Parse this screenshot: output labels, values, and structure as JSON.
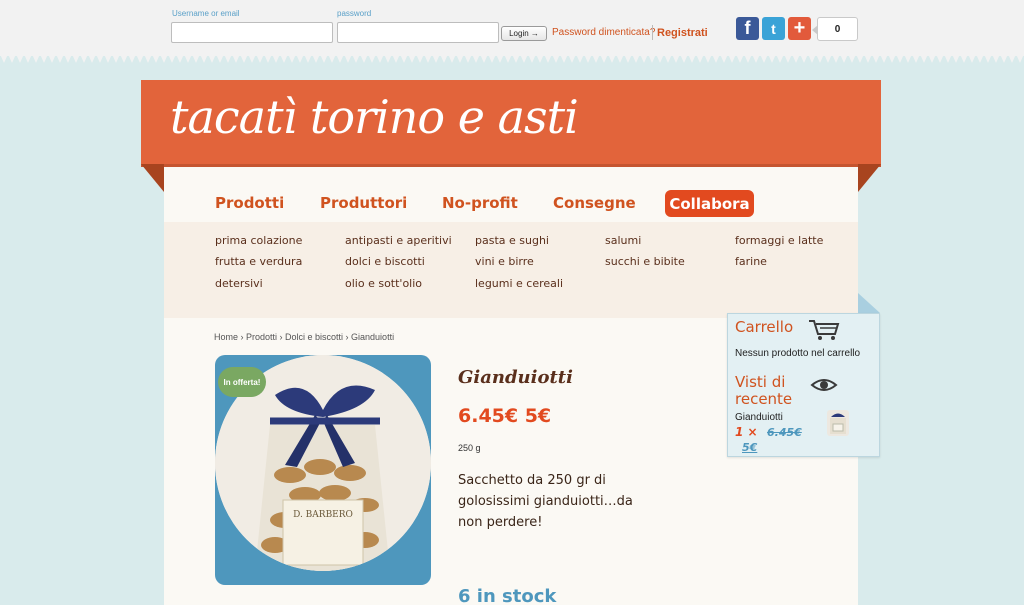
{
  "login": {
    "username_label": "Username or email",
    "password_label": "password",
    "username_value": "",
    "password_value": "",
    "login_button": "Login →",
    "forgot_link": "Password dimenticata?",
    "register_link": "Registrati"
  },
  "social": {
    "facebook_glyph": "f",
    "twitter_glyph": "t",
    "plus_glyph": "+",
    "share_count": "0"
  },
  "site": {
    "title": "tacatì torino e asti",
    "brand_color": "#e2643b"
  },
  "nav": {
    "items": [
      "Prodotti",
      "Produttori",
      "No-profit",
      "Consegne"
    ],
    "highlight": "Collabora"
  },
  "categories": {
    "col1": [
      "prima colazione",
      "frutta e verdura",
      "detersivi"
    ],
    "col2": [
      "antipasti e aperitivi",
      "dolci e biscotti",
      "olio e sott'olio"
    ],
    "col3": [
      "pasta e sughi",
      "vini e birre",
      "legumi e cereali"
    ],
    "col4": [
      "salumi",
      "succhi e bibite"
    ],
    "col5": [
      "formaggi e latte",
      "farine"
    ]
  },
  "breadcrumb": "Home › Prodotti › Dolci e biscotti › Gianduiotti",
  "product": {
    "badge": "In offerta!",
    "name": "Gianduiotti",
    "price": "6.45€ 5€",
    "weight": "250 g",
    "description": "Sacchetto da 250 gr di golosissimi gianduiotti…da non perdere!",
    "stock": "6 in stock",
    "image_label": "D. BARBERO"
  },
  "cart": {
    "title": "Carrello",
    "empty_text": "Nessun prodotto nel carrello",
    "recent_title": "Visti di recente",
    "recent_item_name": "Gianduiotti",
    "recent_item_qty": "1 ×",
    "recent_item_old_price": "6.45€",
    "recent_item_new_price": "5€"
  }
}
